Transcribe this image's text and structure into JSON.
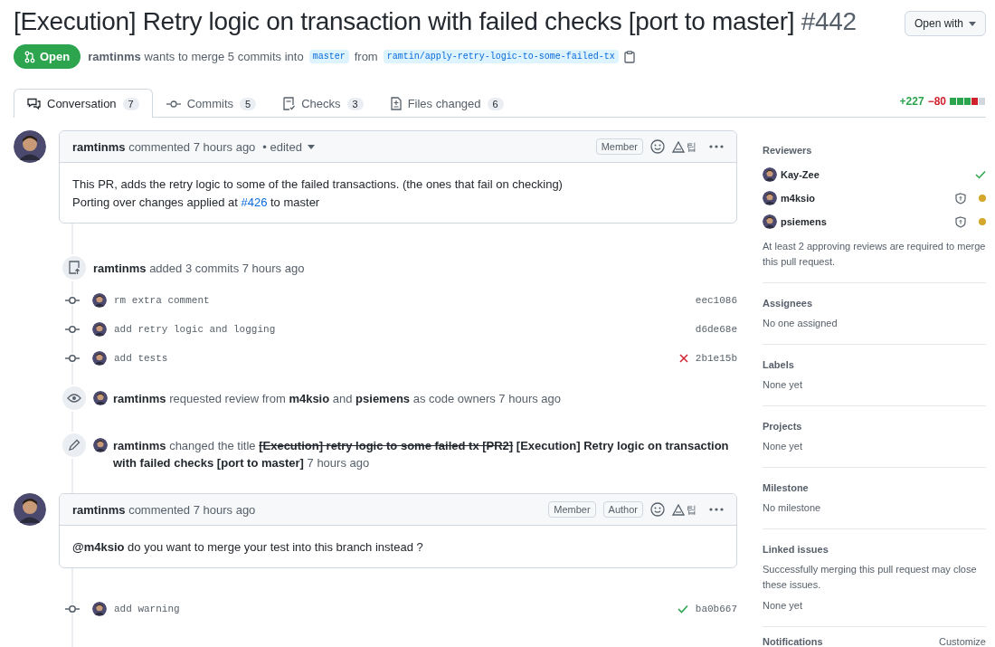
{
  "header": {
    "title": "[Execution] Retry logic on transaction with failed checks [port to master]",
    "number": "#442",
    "open_with": "Open with",
    "state": "Open",
    "author": "ramtinms",
    "summary": "wants to merge 5 commits into",
    "base_branch": "master",
    "from_label": "from",
    "head_branch": "ramtin/apply-retry-logic-to-some-failed-tx"
  },
  "tabs": [
    {
      "label": "Conversation",
      "count": "7",
      "selected": true
    },
    {
      "label": "Commits",
      "count": "5",
      "selected": false
    },
    {
      "label": "Checks",
      "count": "3",
      "selected": false
    },
    {
      "label": "Files changed",
      "count": "6",
      "selected": false
    }
  ],
  "diffstat": {
    "additions": "+227",
    "deletions": "−80",
    "blocks": [
      {
        "kind": "add"
      },
      {
        "kind": "add"
      },
      {
        "kind": "add"
      },
      {
        "kind": "del"
      },
      {
        "kind": "neutral"
      }
    ]
  },
  "timeline": [
    {
      "kind": "comment",
      "author": "ramtinms",
      "meta": "commented 7 hours ago",
      "edited": "• edited",
      "badges": [
        "Member"
      ],
      "reaction_label": "팁",
      "lines": [
        {
          "kind": "text",
          "text": "This PR, adds the retry logic to some of the failed transactions. (the ones that fail on checking)"
        },
        {
          "kind": "link",
          "before": "Porting over changes applied at",
          "link": "#426",
          "after": "to master"
        }
      ]
    },
    {
      "kind": "commits",
      "text": "**ramtinms** added 3 commits 7 hours ago"
    },
    {
      "kind": "commit",
      "message": "rm extra comment",
      "sha": "eec1086",
      "failed": false,
      "passed": false
    },
    {
      "kind": "commit",
      "message": "add retry logic and logging",
      "sha": "d6de68e",
      "failed": false,
      "passed": false
    },
    {
      "kind": "commit",
      "message": "add tests",
      "sha": "2b1e15b",
      "failed": true,
      "passed": false
    },
    {
      "kind": "review_request",
      "text": "**ramtinms** requested review from **m4ksio** and **psiemens** as code owners 7 hours ago"
    },
    {
      "kind": "title_change",
      "actor": "ramtinms",
      "verb": "changed the title",
      "old_title": "[Execution] retry logic to some failed tx [PR2]",
      "new_title": "[Execution] Retry logic on transaction with failed checks [port to master]",
      "time": "7 hours ago"
    },
    {
      "kind": "comment",
      "author": "ramtinms",
      "meta": "commented 7 hours ago",
      "badges": [
        "Member",
        "Author"
      ],
      "reaction_label": "팁",
      "lines": [
        {
          "kind": "text",
          "text": "**@m4ksio** do you want to merge your test into this branch instead ?"
        }
      ]
    },
    {
      "kind": "commit",
      "message": "add warning",
      "sha": "ba0b667",
      "failed": false,
      "passed": true
    }
  ],
  "sidebar": {
    "reviewers": {
      "title": "Reviewers",
      "items": [
        {
          "name": "Kay-Zee",
          "code_owner": false,
          "approved": true
        },
        {
          "name": "m4ksio",
          "code_owner": true,
          "approved": false
        },
        {
          "name": "psiemens",
          "code_owner": true,
          "approved": false
        }
      ],
      "note": "At least 2 approving reviews are required to merge this pull request."
    },
    "sections": [
      {
        "title": "Assignees",
        "lines": [
          "No one assigned"
        ]
      },
      {
        "title": "Labels",
        "lines": [
          "None yet"
        ]
      },
      {
        "title": "Projects",
        "lines": [
          "None yet"
        ]
      },
      {
        "title": "Milestone",
        "lines": [
          "No milestone"
        ]
      },
      {
        "title": "Linked issues",
        "lines": [
          "Successfully merging this pull request may close these issues.",
          "None yet"
        ]
      }
    ],
    "notifications": {
      "title": "Notifications",
      "action": "Customize"
    }
  }
}
